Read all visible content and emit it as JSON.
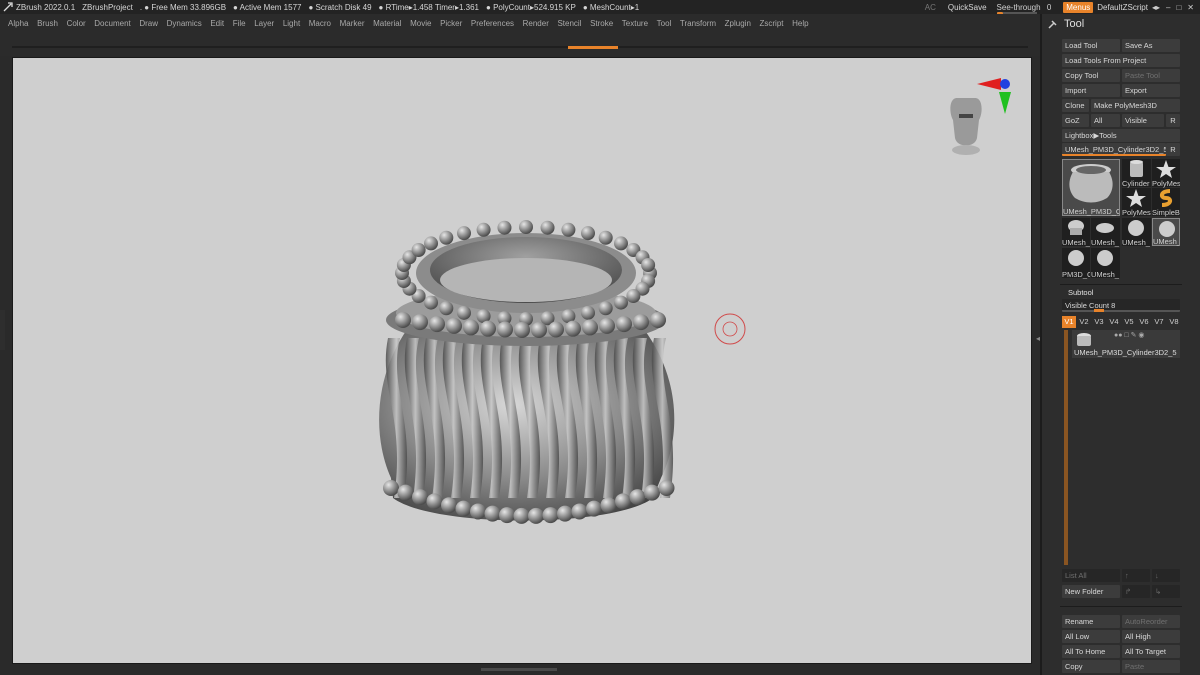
{
  "titlebar": {
    "app": "ZBrush 2022.0.1",
    "project": "ZBrushProject",
    "free_mem": ". ● Free Mem 33.896GB",
    "active_mem": "● Active Mem 1577",
    "scratch": "● Scratch Disk 49",
    "rtime": "● RTime▸1.458 Timer▸1.361",
    "polycount": "● PolyCount▸524.915 KP",
    "meshcount": "● MeshCount▸1",
    "ac": "AC",
    "quicksave": "QuickSave",
    "see_through_label": "See-through",
    "see_through_value": "0",
    "menus": "Menus",
    "default_zscript": "DefaultZScript"
  },
  "menubar": [
    "Alpha",
    "Brush",
    "Color",
    "Document",
    "Draw",
    "Dynamics",
    "Edit",
    "File",
    "Layer",
    "Light",
    "Macro",
    "Marker",
    "Material",
    "Movie",
    "Picker",
    "Preferences",
    "Render",
    "Stencil",
    "Stroke",
    "Texture",
    "Tool",
    "Transform",
    "Zplugin",
    "Zscript",
    "Help"
  ],
  "panel": {
    "title": "Tool",
    "buttons": {
      "load_tool": "Load Tool",
      "save_as": "Save As",
      "load_tools_from_project": "Load Tools From Project",
      "copy_tool": "Copy Tool",
      "paste_tool": "Paste Tool",
      "import": "Import",
      "export": "Export",
      "clone": "Clone",
      "make_polymesh3d": "Make PolyMesh3D",
      "goz": "GoZ",
      "all": "All",
      "visible": "Visible",
      "r": "R",
      "lightbox_tools": "Lightbox▶Tools",
      "current_tool": "UMesh_PM3D_Cylinder3D2_5",
      "r2": "R"
    },
    "thumbs": {
      "main": "UMesh_PM3D_C",
      "cylinder": "Cylinder",
      "polymesh": "PolyMes",
      "polymesh2": "PolyMes",
      "simpleb": "SimpleB",
      "u1": "UMesh_",
      "u2": "UMesh_",
      "u3": "UMesh_",
      "u4": "UMesh_",
      "p1": "PM3D_C",
      "u5": "UMesh_"
    },
    "subtool": {
      "title": "Subtool",
      "visible_count": "Visible Count 8",
      "versions": [
        "V1",
        "V2",
        "V3",
        "V4",
        "V5",
        "V6",
        "V7",
        "V8"
      ],
      "item_name": "UMesh_PM3D_Cylinder3D2_5"
    },
    "lower": {
      "list_all": "List All",
      "new_folder": "New Folder",
      "rename": "Rename",
      "autoreorder": "AutoReorder",
      "all_low": "All Low",
      "all_high": "All High",
      "all_to_home": "All To Home",
      "all_to_target": "All To Target",
      "copy": "Copy",
      "paste": "Paste"
    }
  },
  "colors": {
    "accent": "#e8832a",
    "viewport": "#cfcfcf",
    "panel": "#2d2d2d"
  }
}
